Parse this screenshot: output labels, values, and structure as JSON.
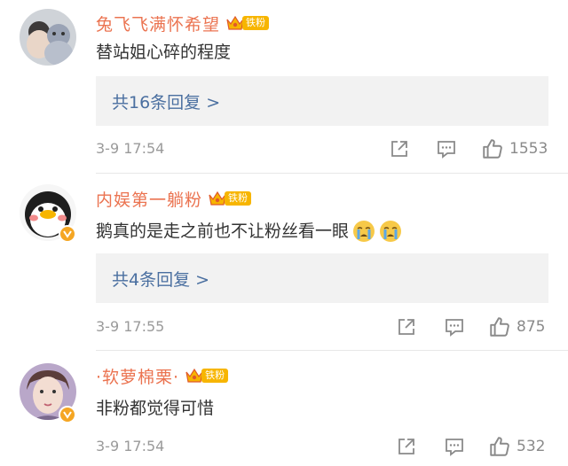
{
  "comments": [
    {
      "username": "兔飞飞满怀希望",
      "fan_badge": "铁粉",
      "text": "替站姐心碎的程度",
      "replies_label": "共16条回复 >",
      "time": "3-9 17:54",
      "likes": "1553",
      "verified": false
    },
    {
      "username": "内娱第一躺粉",
      "fan_badge": "铁粉",
      "text": "鹅真的是走之前也不让粉丝看一眼",
      "emojis": [
        "crying-emoji",
        "crying-emoji"
      ],
      "replies_label": "共4条回复 >",
      "time": "3-9 17:55",
      "likes": "875",
      "verified": true
    },
    {
      "username": "·软萝棉栗·",
      "fan_badge": "铁粉",
      "text": "非粉都觉得可惜",
      "time": "3-9 17:54",
      "likes": "532",
      "verified": true
    }
  ],
  "colors": {
    "username": "#eb7350",
    "reply_link": "#4a6fa0",
    "badge": "#f7b500",
    "reply_bg": "#f2f2f2"
  }
}
